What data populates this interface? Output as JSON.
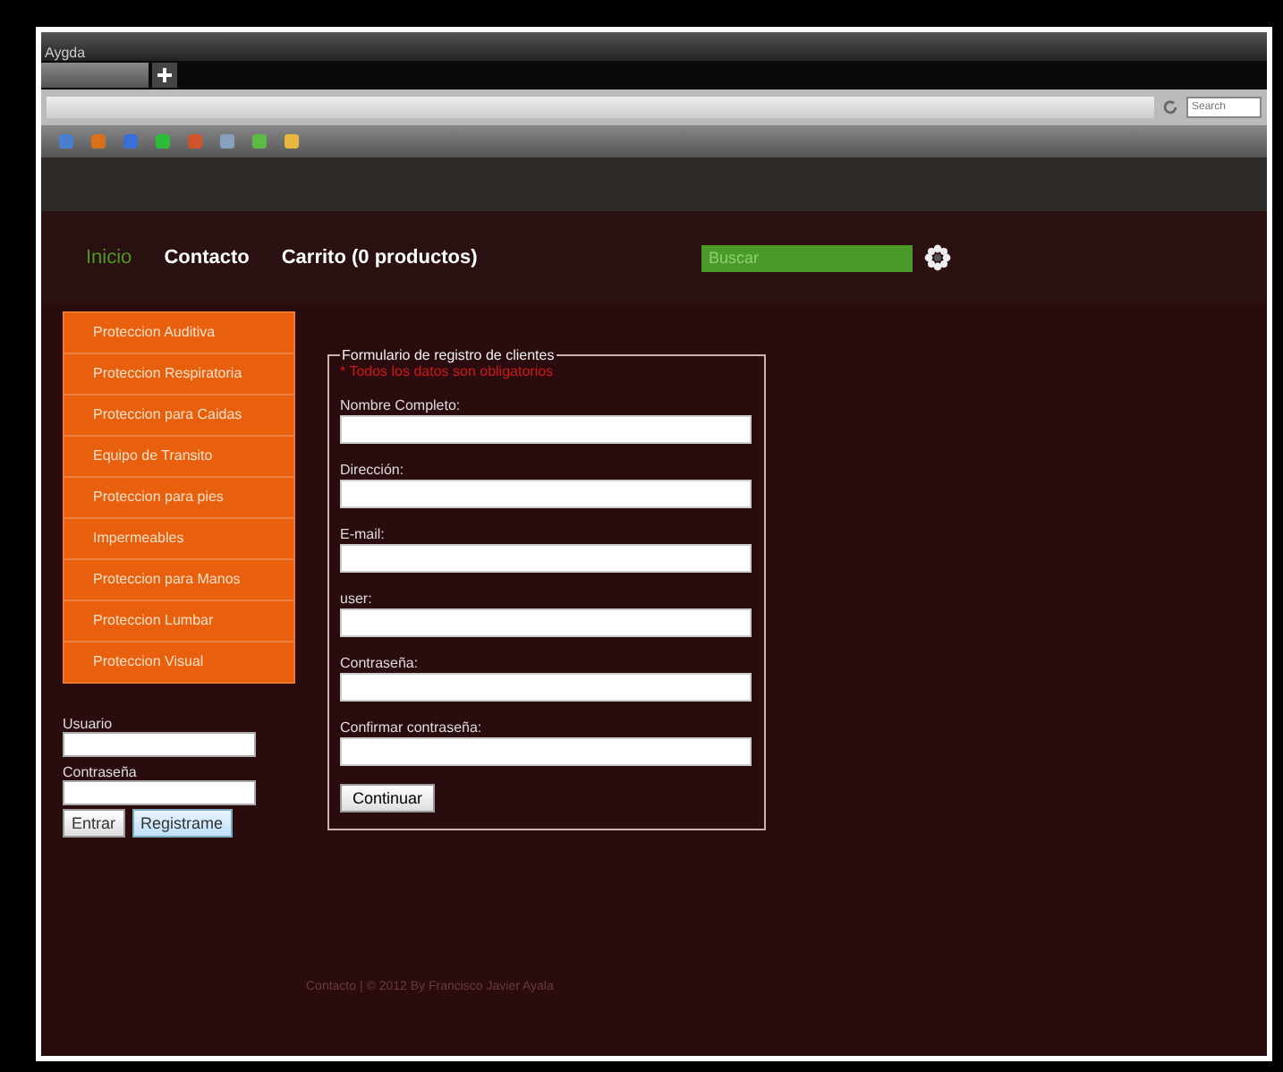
{
  "window": {
    "title": "Aygda"
  },
  "browser": {
    "search_placeholder": "Search"
  },
  "nav": [
    {
      "label": "Inicio",
      "selected": true
    },
    {
      "label": "Contacto",
      "selected": false
    },
    {
      "label": "Carrito (0 productos)",
      "selected": false
    }
  ],
  "search": {
    "placeholder": "Buscar"
  },
  "sidebar": {
    "items": [
      "Proteccion Auditiva",
      "Proteccion Respiratoria",
      "Proteccion para Caidas",
      "Equipo de Transito",
      "Proteccion para pies",
      "Impermeables",
      "Proteccion para Manos",
      "Proteccion Lumbar",
      "Proteccion Visual"
    ]
  },
  "login": {
    "fields": [
      {
        "label": "Usuario"
      },
      {
        "label": "Contraseña"
      }
    ],
    "buttons": [
      {
        "label": "Entrar",
        "kind": "plain"
      },
      {
        "label": "Registrame",
        "kind": "primary"
      }
    ]
  },
  "form": {
    "legend": "Formulario de registro de clientes",
    "note": "* Todos los datos son obligatorios",
    "fields": [
      {
        "label": "Nombre Completo:"
      },
      {
        "label": "Dirección:"
      },
      {
        "label": "E-mail:"
      },
      {
        "label": "user:"
      },
      {
        "label": "Contraseña:"
      },
      {
        "label": "Confirmar contraseña:"
      }
    ],
    "submit": "Continuar"
  },
  "footer": "Contacto | © 2012 By Francisco Javier Ayala"
}
